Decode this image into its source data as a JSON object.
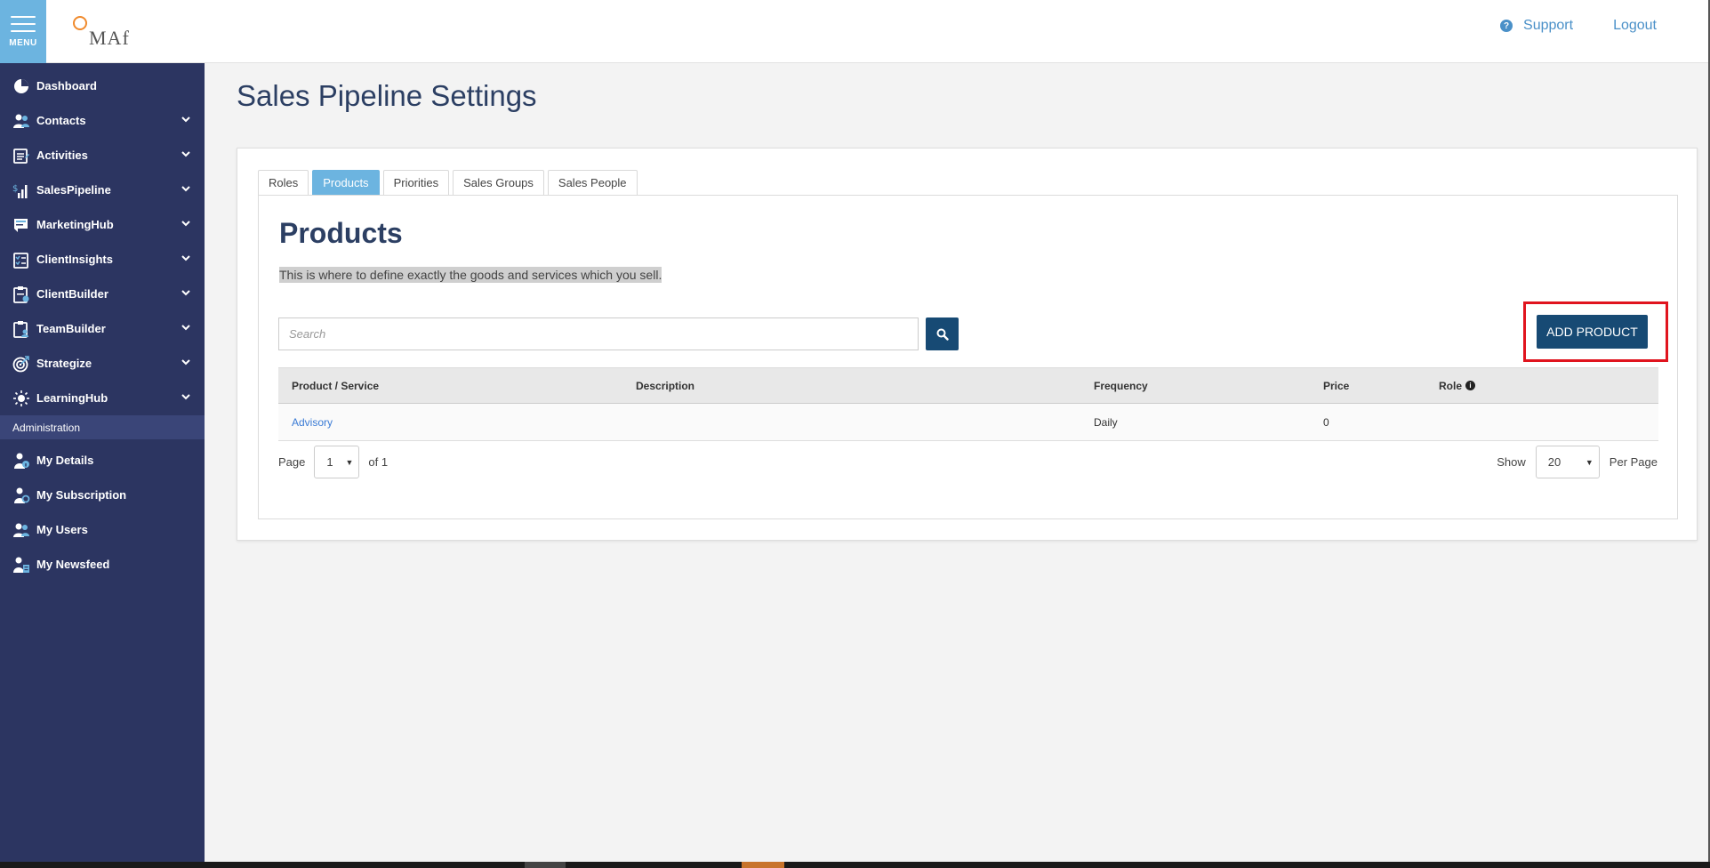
{
  "topbar": {
    "menu_label": "MENU",
    "logo_text": "MAf",
    "support_label": "Support",
    "logout_label": "Logout"
  },
  "sidebar": {
    "items": [
      {
        "label": "Dashboard",
        "icon": "pie-chart-icon",
        "expandable": false
      },
      {
        "label": "Contacts",
        "icon": "users-icon",
        "expandable": true
      },
      {
        "label": "Activities",
        "icon": "calendar-icon",
        "expandable": true
      },
      {
        "label": "SalesPipeline",
        "icon": "bar-chart-icon",
        "expandable": true
      },
      {
        "label": "MarketingHub",
        "icon": "envelope-icon",
        "expandable": true
      },
      {
        "label": "ClientInsights",
        "icon": "checklist-icon",
        "expandable": true
      },
      {
        "label": "ClientBuilder",
        "icon": "clipboard-icon",
        "expandable": true
      },
      {
        "label": "TeamBuilder",
        "icon": "clipboard-team-icon",
        "expandable": true
      },
      {
        "label": "Strategize",
        "icon": "target-icon",
        "expandable": true
      },
      {
        "label": "LearningHub",
        "icon": "lightbulb-icon",
        "expandable": true
      }
    ],
    "admin_header": "Administration",
    "admin_items": [
      {
        "label": "My Details",
        "icon": "user-info-icon"
      },
      {
        "label": "My Subscription",
        "icon": "user-refresh-icon"
      },
      {
        "label": "My Users",
        "icon": "users-icon"
      },
      {
        "label": "My Newsfeed",
        "icon": "user-news-icon"
      }
    ]
  },
  "main": {
    "page_title": "Sales Pipeline Settings",
    "tabs": [
      {
        "label": "Roles",
        "active": false
      },
      {
        "label": "Products",
        "active": true
      },
      {
        "label": "Priorities",
        "active": false
      },
      {
        "label": "Sales Groups",
        "active": false
      },
      {
        "label": "Sales People",
        "active": false
      }
    ],
    "panel_title": "Products",
    "description": "This is where to define exactly the goods and services which you sell.",
    "search": {
      "placeholder": "Search",
      "value": ""
    },
    "add_button_label": "ADD PRODUCT",
    "table": {
      "columns": [
        "Product / Service",
        "Description",
        "Frequency",
        "Price",
        "Role"
      ],
      "rows": [
        {
          "product": "Advisory",
          "description": "",
          "frequency": "Daily",
          "price": "0",
          "role": ""
        }
      ]
    },
    "pager": {
      "page_label": "Page",
      "current_page": "1",
      "of_label": "of 1",
      "show_label": "Show",
      "per_page_value": "20",
      "per_page_label": "Per Page"
    }
  },
  "colors": {
    "sidebar_bg": "#2c3561",
    "accent": "#6cb4e0",
    "primary_button": "#174a74",
    "highlight_border": "#e0141e",
    "link": "#3a7bd5"
  }
}
